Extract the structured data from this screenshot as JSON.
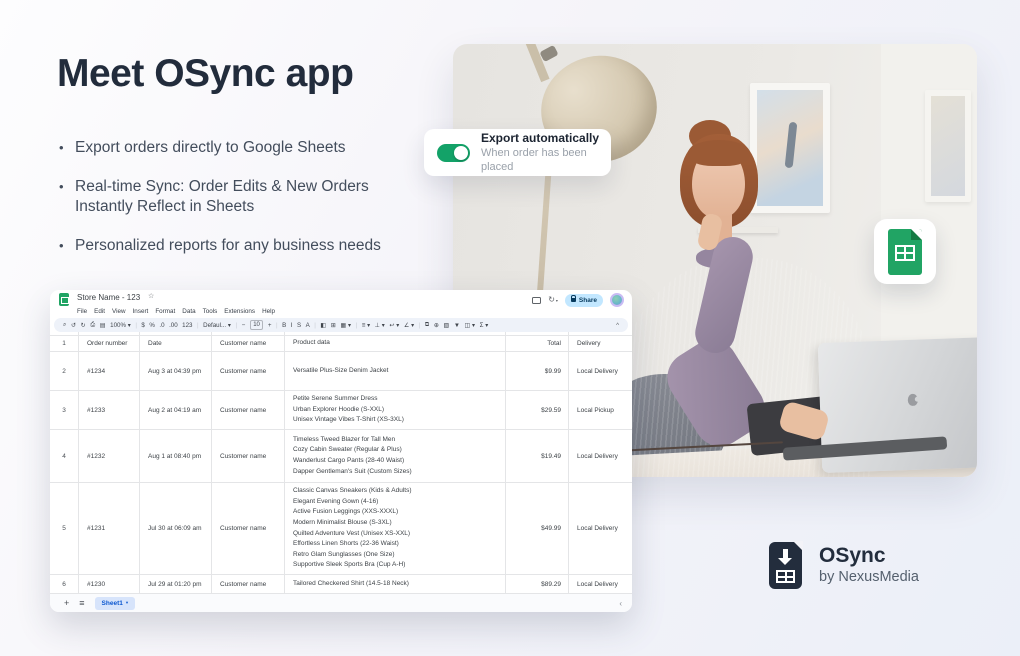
{
  "hero": {
    "title": "Meet OSync app",
    "bullets": [
      "Export orders directly to Google Sheets",
      "Real-time Sync: Order Edits & New Orders\nInstantly Reflect in Sheets",
      "Personalized reports for any business needs"
    ]
  },
  "toggle_card": {
    "title": "Export automatically",
    "subtitle": "When order has been placed",
    "state": "on",
    "toggle_color": "#13a268"
  },
  "sheets_badge": {
    "icon": "google-sheets-icon",
    "color": "#21a464"
  },
  "brand": {
    "name": "OSync",
    "byline": "by NexusMedia",
    "color": "#232d3d"
  },
  "sheet": {
    "title": "Store Name - 123",
    "star": "☆",
    "menus": [
      "File",
      "Edit",
      "View",
      "Insert",
      "Format",
      "Data",
      "Tools",
      "Extensions",
      "Help"
    ],
    "toolbar": [
      "⌕",
      "↺",
      "↻",
      "⎙",
      "▤",
      "100% ▾",
      "|",
      "$",
      "%",
      ".0",
      ".00",
      "123",
      "|",
      "Defaul... ▾",
      "|",
      "−",
      "10",
      "+",
      "|",
      "B",
      "I",
      "S",
      "A",
      "|",
      "◧",
      "⊞",
      "▦ ▾",
      "|",
      "≡ ▾",
      "⊥ ▾",
      "↩ ▾",
      "∠ ▾",
      "|",
      "⧉",
      "⊕",
      "▧",
      "▼",
      "◫ ▾",
      "Σ ▾"
    ],
    "collapse": "^",
    "share": "Share",
    "header_row": {
      "n": "1",
      "cols": [
        "Order number",
        "Date",
        "Customer name",
        "Product data",
        "Total",
        "Delivery"
      ]
    },
    "rows": [
      {
        "n": "2",
        "order": "#1234",
        "date": "Aug 3 at 04:39 pm",
        "customer": "Customer name",
        "products": [
          "Versatile Plus-Size Denim Jacket"
        ],
        "total": "$9.99",
        "delivery": "Local Delivery"
      },
      {
        "n": "3",
        "order": "#1233",
        "date": "Aug 2 at 04:19 am",
        "customer": "Customer name",
        "products": [
          "Petite Serene Summer Dress",
          "Urban Explorer Hoodie (S-XXL)",
          "Unisex Vintage Vibes T-Shirt (XS-3XL)"
        ],
        "total": "$29.59",
        "delivery": "Local Pickup"
      },
      {
        "n": "4",
        "order": "#1232",
        "date": "Aug 1 at 08:40 pm",
        "customer": "Customer name",
        "products": [
          "Timeless Tweed Blazer for Tall Men",
          "Cozy Cabin Sweater (Regular & Plus)",
          "Wanderlust Cargo Pants (28-40 Waist)",
          "Dapper Gentleman's Suit (Custom Sizes)"
        ],
        "total": "$19.49",
        "delivery": "Local Delivery"
      },
      {
        "n": "5",
        "order": "#1231",
        "date": "Jul 30 at 06:09 am",
        "customer": "Customer name",
        "products": [
          "Classic Canvas Sneakers (Kids & Adults)",
          "Elegant Evening Gown (4-16)",
          "Active Fusion Leggings (XXS-XXXL)",
          "Modern Minimalist Blouse (S-3XL)",
          "Quilted Adventure Vest (Unisex XS-XXL)",
          "Effortless Linen Shorts (22-36 Waist)",
          "Retro Glam Sunglasses (One Size)",
          "Supportive Sleek Sports Bra (Cup A-H)"
        ],
        "total": "$49.99",
        "delivery": "Local Delivery"
      },
      {
        "n": "6",
        "order": "#1230",
        "date": "Jul 29 at 01:20 pm",
        "customer": "Customer name",
        "products": [
          "Tailored Checkered Shirt (14.5-18 Neck)"
        ],
        "total": "$89.29",
        "delivery": "Local Delivery"
      }
    ],
    "footer": {
      "add": "+",
      "all_sheets": "≡",
      "tab": "Sheet1",
      "tab_caret": "▾",
      "scroll_left": "‹"
    }
  }
}
